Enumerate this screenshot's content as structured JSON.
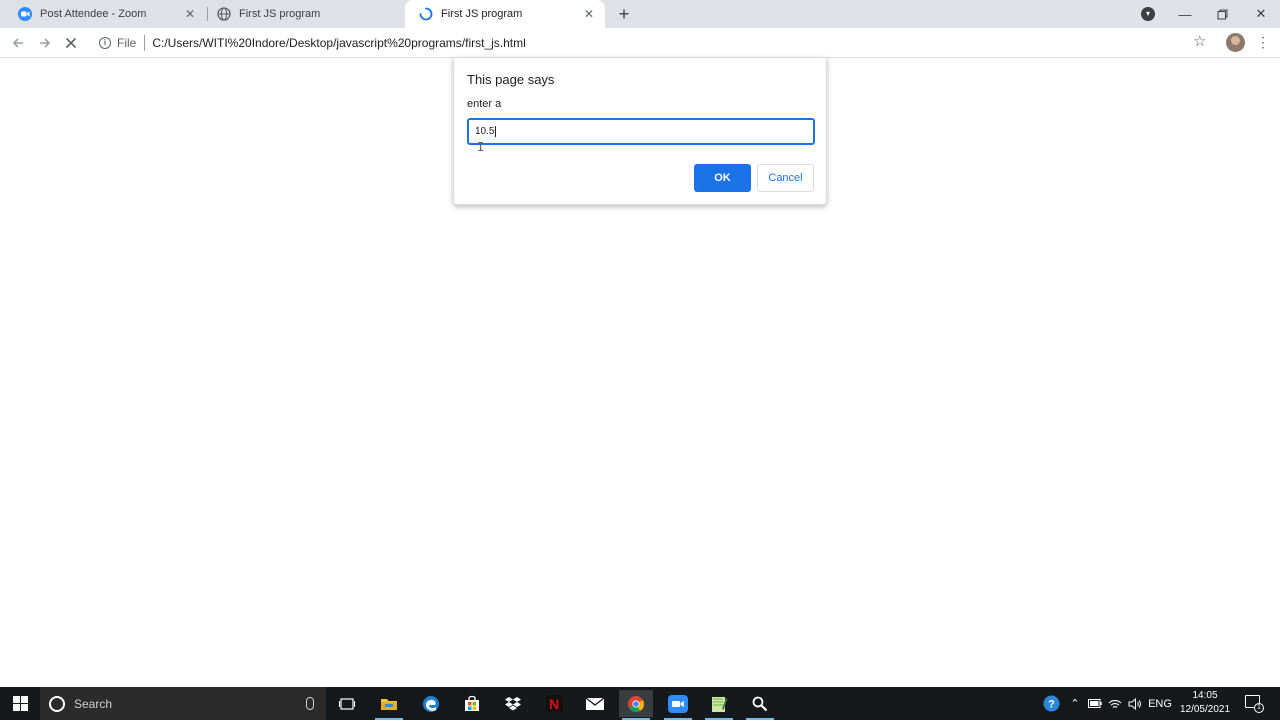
{
  "browser": {
    "tabs": [
      {
        "title": "Post Attendee - Zoom",
        "icon": "zoom-icon",
        "active": false
      },
      {
        "title": "First JS program",
        "icon": "globe-icon",
        "active": false
      },
      {
        "title": "First JS program",
        "icon": "loading-spinner-icon",
        "active": true
      }
    ],
    "new_tab": "+",
    "address": {
      "protocol_label": "File",
      "url": "C:/Users/WITI%20Indore/Desktop/javascript%20programs/first_js.html"
    }
  },
  "dialog": {
    "title": "This page says",
    "message": "enter a",
    "input_value": "10.5",
    "ok_label": "OK",
    "cancel_label": "Cancel"
  },
  "taskbar": {
    "search_placeholder": "Search",
    "apps": [
      "task-view",
      "file-explorer",
      "edge",
      "microsoft-store",
      "dropbox",
      "netflix",
      "mail",
      "chrome",
      "zoom",
      "notepad-plus-plus",
      "search-tool"
    ],
    "tray": {
      "language": "ENG",
      "time": "14:05",
      "date": "12/05/2021",
      "notifications_count": "1"
    }
  },
  "colors": {
    "accent": "#1a73e8",
    "tabstrip": "#dee1e6",
    "taskbar": "#16191c"
  }
}
